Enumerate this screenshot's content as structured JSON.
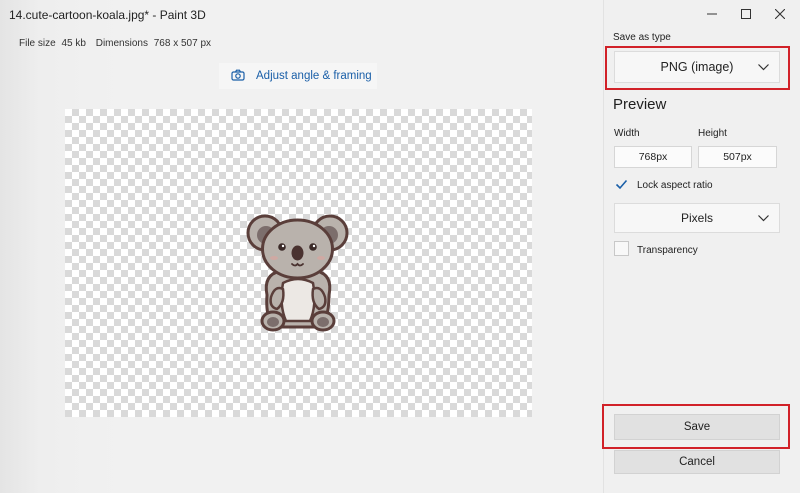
{
  "window": {
    "title": "14.cute-cartoon-koala.jpg* - Paint 3D",
    "minimize_icon": "minimize-icon",
    "maximize_icon": "maximize-icon",
    "close_icon": "close-icon"
  },
  "file_info": {
    "size_label": "File size",
    "size_value": "45 kb",
    "dimensions_label": "Dimensions",
    "dimensions_value": "768 x 507 px"
  },
  "adjust_button": {
    "label": "Adjust angle & framing",
    "icon": "camera-icon",
    "color": "#1a5fa8"
  },
  "side_panel": {
    "save_as_label": "Save as type",
    "save_as_value": "PNG (image)",
    "preview_heading": "Preview",
    "width_label": "Width",
    "height_label": "Height",
    "width_value": "768px",
    "height_value": "507px",
    "lock_label": "Lock aspect ratio",
    "lock_checked": true,
    "units_value": "Pixels",
    "transparency_label": "Transparency",
    "transparency_checked": false,
    "save_label": "Save",
    "cancel_label": "Cancel",
    "highlight_color": "#d12128"
  }
}
